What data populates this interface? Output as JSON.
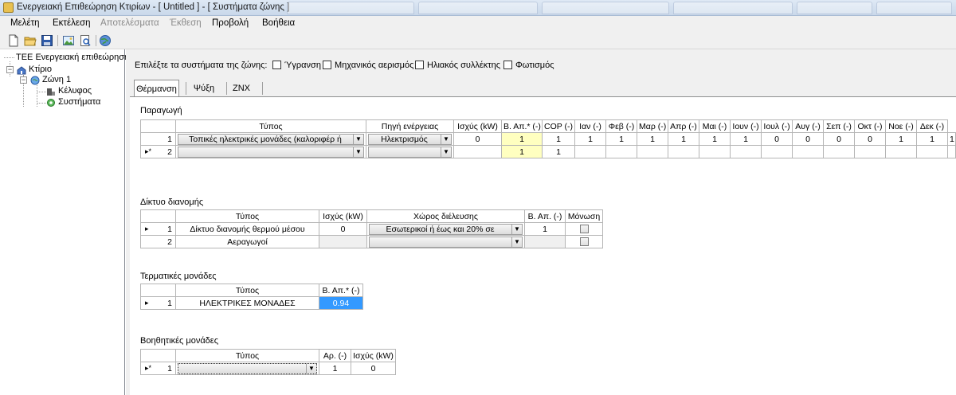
{
  "window": {
    "title": "Ενεργειακή Επιθεώρηση Κτιρίων - [ Untitled ] - [ Συστήματα ζώνης ]"
  },
  "menu": [
    {
      "label": "Μελέτη",
      "disabled": false
    },
    {
      "label": "Εκτέλεση",
      "disabled": false
    },
    {
      "label": "Αποτελέσματα",
      "disabled": true
    },
    {
      "label": "Έκθεση",
      "disabled": true
    },
    {
      "label": "Προβολή",
      "disabled": false
    },
    {
      "label": "Βοήθεια",
      "disabled": false
    }
  ],
  "toolbar": {
    "icons": [
      "new-file-icon",
      "open-folder-icon",
      "save-icon",
      "image-icon",
      "print-preview-icon",
      "globe-icon"
    ]
  },
  "tree": {
    "root": "ΤΕΕ Ενεργειακή επιθεώρηση",
    "building": "Κτίριο",
    "zone": "Ζώνη 1",
    "shell": "Κέλυφος",
    "systems": "Συστήματα"
  },
  "zone_systems": {
    "prompt": "Επιλέξτε τα συστήματα της ζώνης:",
    "options": [
      {
        "label": "Ύγρανση",
        "checked": false
      },
      {
        "label": "Μηχανικός αερισμός",
        "checked": false
      },
      {
        "label": "Ηλιακός συλλέκτης",
        "checked": false
      },
      {
        "label": "Φωτισμός",
        "checked": false
      }
    ]
  },
  "tabs": [
    "Θέρμανση",
    "Ψύξη",
    "ΖΝΧ"
  ],
  "active_tab": "Θέρμανση",
  "production": {
    "title": "Παραγωγή",
    "headers": [
      "Τύπος",
      "Πηγή ενέργειας",
      "Ισχύς (kW)",
      "Β. Απ.* (-)",
      "COP (-)",
      "Ιαν (-)",
      "Φεβ (-)",
      "Μαρ (-)",
      "Απρ (-)",
      "Μαι (-)",
      "Ιουν (-)",
      "Ιουλ (-)",
      "Αυγ (-)",
      "Σεπ (-)",
      "Οκτ (-)",
      "Νοε (-)",
      "Δεκ (-)"
    ],
    "rows": [
      {
        "num": "1",
        "marker": "",
        "type": "Τοπικές ηλεκτρικές μονάδες (καλοριφέρ ή",
        "source": "Ηλεκτρισμός",
        "power": "0",
        "ba": "1",
        "cop": "1",
        "months": [
          "1",
          "1",
          "1",
          "1",
          "1",
          "1",
          "0",
          "0",
          "0",
          "0",
          "1",
          "1",
          "1"
        ]
      },
      {
        "num": "2",
        "marker": "▸*",
        "type": "",
        "source": "",
        "power": "",
        "ba": "1",
        "cop": "1",
        "months": [
          "",
          "",
          "",
          "",
          "",
          "",
          "",
          "",
          "",
          "",
          "",
          "",
          ""
        ]
      }
    ]
  },
  "distribution": {
    "title": "Δίκτυο διανομής",
    "headers": [
      "Τύπος",
      "Ισχύς (kW)",
      "Χώρος διέλευσης",
      "Β. Απ. (-)",
      "Μόνωση"
    ],
    "rows": [
      {
        "num": "1",
        "marker": "▸",
        "type": "Δίκτυο διανομής θερμού μέσου",
        "power": "0",
        "space": "Εσωτερικοί  ή έως και 20% σε",
        "ba": "1",
        "insulation": false
      },
      {
        "num": "2",
        "marker": "",
        "type": "Αεραγωγοί",
        "power": "",
        "space": "",
        "ba": "",
        "insulation": false
      }
    ]
  },
  "terminal": {
    "title": "Τερματικές μονάδες",
    "headers": [
      "Τύπος",
      "Β. Απ.* (-)"
    ],
    "rows": [
      {
        "num": "1",
        "marker": "▸",
        "type": "ΗΛΕΚΤΡΙΚΕΣ ΜΟΝΑΔΕΣ",
        "ba": "0.94"
      }
    ]
  },
  "auxiliary": {
    "title": "Βοηθητικές μονάδες",
    "headers": [
      "Τύπος",
      "Αρ. (-)",
      "Ισχύς (kW)"
    ],
    "rows": [
      {
        "num": "1",
        "marker": "▸*",
        "type": "",
        "count": "1",
        "power": "0"
      }
    ]
  }
}
